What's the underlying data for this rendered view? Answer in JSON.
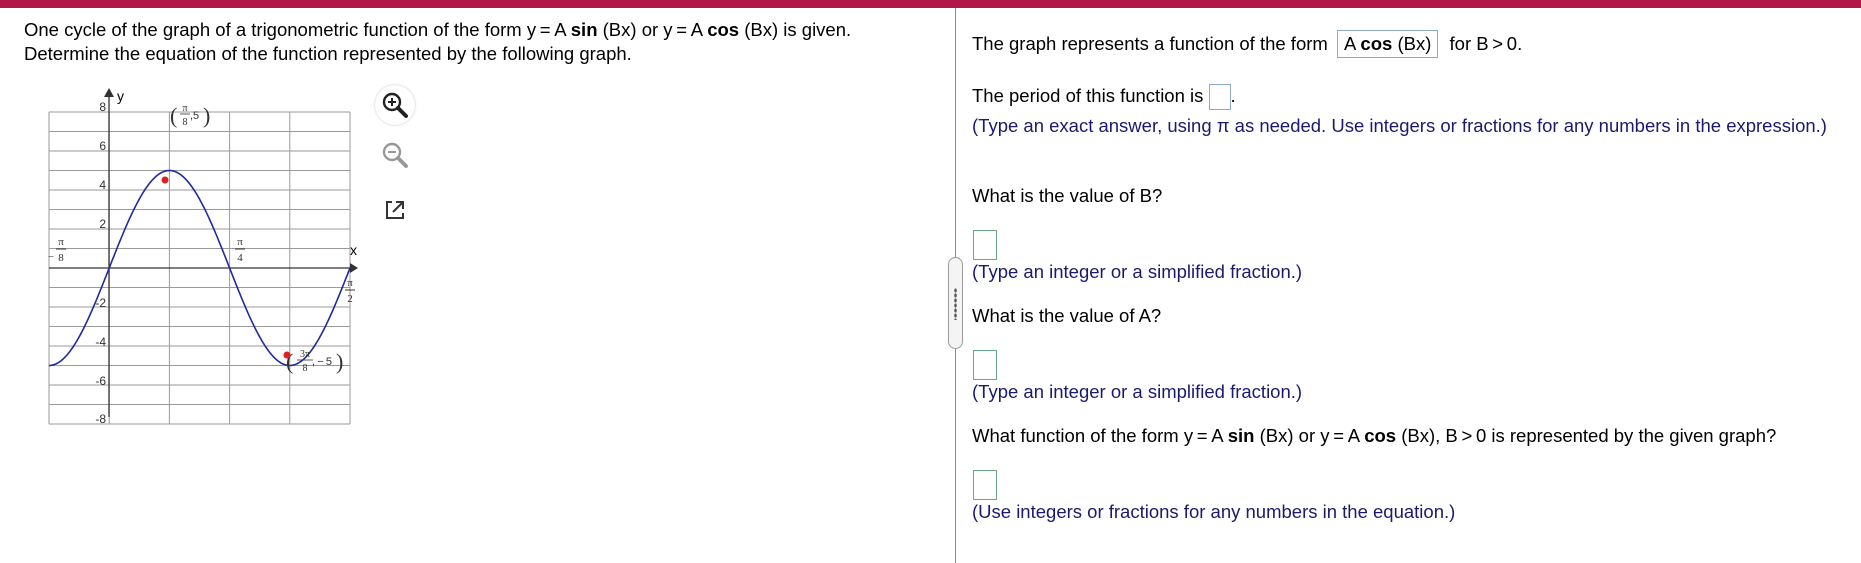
{
  "question": {
    "line1_prefix": "One cycle of the graph of a trigonometric function of the form y = A ",
    "sin_word": "sin",
    "line1_mid": " (Bx) or y = A ",
    "cos_word": "cos",
    "line1_suffix": " (Bx) is given.",
    "line2": "Determine the equation of the function represented by the following graph."
  },
  "graph": {
    "y_axis_label": "y",
    "x_axis_label": "x",
    "y_ticks": [
      "8",
      "6",
      "4",
      "2",
      "-2",
      "-4",
      "-6",
      "-8"
    ],
    "x_tick_left": {
      "num": "π",
      "den": "8",
      "sign": "−"
    },
    "x_tick_mid": {
      "num": "π",
      "den": "4"
    },
    "x_tick_right": {
      "num": "π",
      "den": "2"
    },
    "point_max_label": {
      "num": "π",
      "den": "8",
      "y": ",5"
    },
    "point_min_label": {
      "num": "3π",
      "den": "8",
      "y": ", − 5"
    },
    "curve_color": "#1f2aa0",
    "point_color": "#e02020"
  },
  "tools": {
    "zoom_in": "zoom-in-icon",
    "zoom_out": "zoom-out-icon",
    "popout": "popout-icon"
  },
  "right": {
    "form_prefix": "The graph represents a function of the form",
    "form_box_A": "A ",
    "form_box_cos": "cos",
    "form_box_arg": " (Bx)",
    "form_suffix": "for B > 0.",
    "period_prefix": "The period of this function is",
    "period_suffix": ".",
    "period_hint": "(Type an exact answer, using π as needed. Use integers or fractions for any numbers in the expression.)",
    "b_question": "What is the value of B?",
    "b_hint": "(Type an integer or a simplified fraction.)",
    "a_question": "What is the value of A?",
    "a_hint": "(Type an integer or a simplified fraction.)",
    "f_question_prefix": "What function of the form y = A ",
    "f_sin": "sin",
    "f_mid": " (Bx) or y = A ",
    "f_cos": "cos",
    "f_suffix": " (Bx), B > 0 is represented by the given graph?",
    "f_hint": "(Use integers or fractions for any numbers in the equation.)"
  },
  "colors": {
    "topbar": "#b0164a",
    "hint_text": "#1a1a6e"
  }
}
